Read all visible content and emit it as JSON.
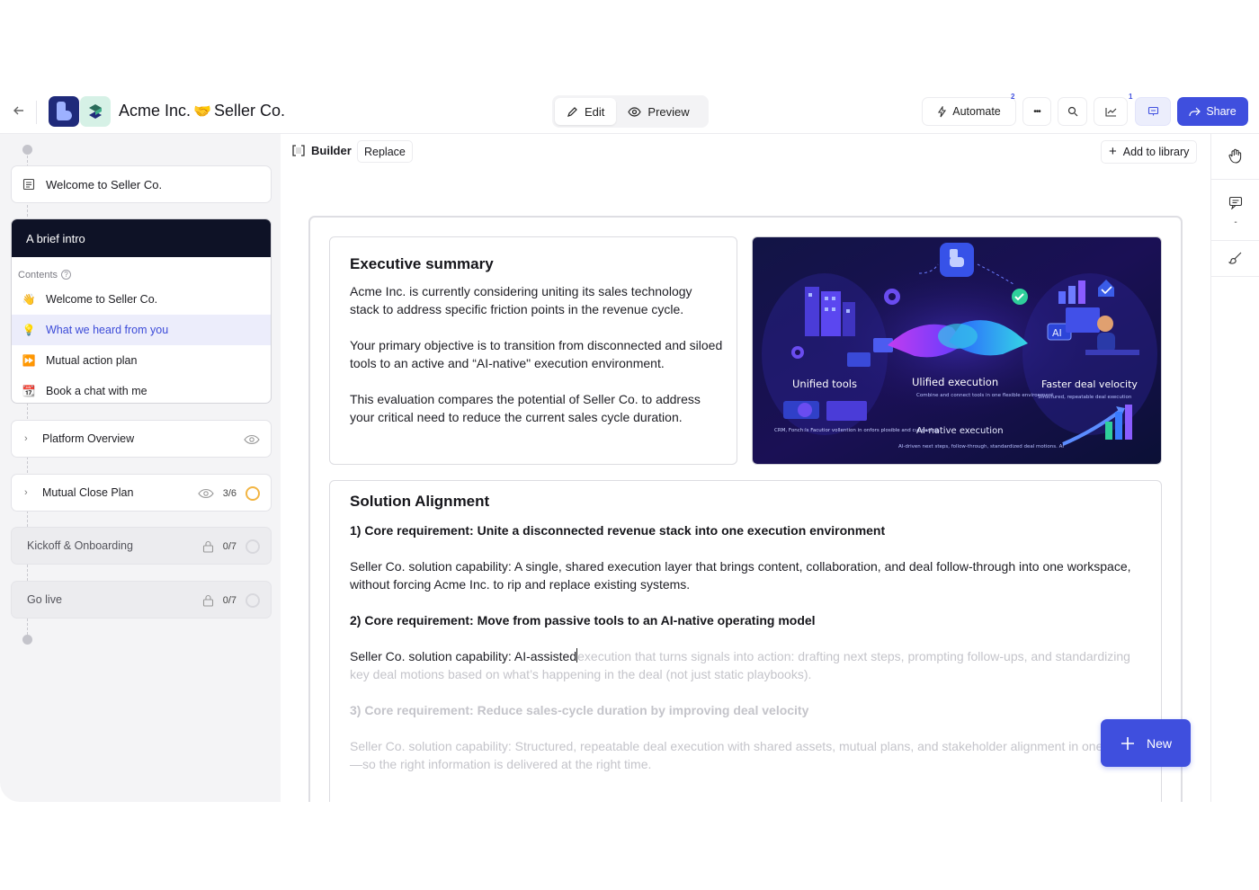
{
  "header": {
    "title_left": "Acme Inc.",
    "title_sep": "🤝",
    "title_right": "Seller Co.",
    "modes": [
      {
        "label": "Edit",
        "icon": "pencil-icon",
        "active": true
      },
      {
        "label": "Preview",
        "icon": "eye-icon",
        "active": false
      }
    ],
    "automate_label": "Automate",
    "automate_badge": "2",
    "activity_badge": "1",
    "share_label": "Share"
  },
  "sidebar": {
    "welcome_card": "Welcome to Seller Co.",
    "intro": {
      "title": "A brief intro",
      "contents_label": "Contents",
      "items": [
        {
          "label": "Welcome to Seller Co.",
          "icon": "👋",
          "active": false
        },
        {
          "label": "What we heard from you",
          "icon": "💡",
          "active": true
        },
        {
          "label": "Mutual action plan",
          "icon": "⏩",
          "active": false
        },
        {
          "label": "Book a chat with me",
          "icon": "📆",
          "active": false
        }
      ]
    },
    "sections": [
      {
        "label": "Platform Overview",
        "progress": ""
      },
      {
        "label": "Mutual Close Plan",
        "progress": "3/6"
      },
      {
        "label": "Kickoff & Onboarding",
        "progress": "0/7"
      },
      {
        "label": "Go live",
        "progress": "0/7"
      }
    ]
  },
  "toolbar": {
    "builder_label": "Builder",
    "replace_label": "Replace",
    "add_library_label": "Add to library"
  },
  "executive": {
    "title": "Executive summary",
    "paragraphs": [
      "Acme Inc. is currently considering uniting its sales technology stack to address specific friction points in the revenue cycle.",
      "Your primary objective is to transition from disconnected and siloed tools to an active and “AI-native\" execution environment.",
      "This evaluation compares the potential of Seller Co. to address your critical need to reduce the current sales cycle duration."
    ]
  },
  "illustration": {
    "label_unified_tools": "Unified tools",
    "label_unified_execution": "Ulified execution",
    "sub_unified_execution": "Combine and connect tools in one flexible environment",
    "label_velocity": "Faster deal velocity",
    "sub_velocity": "Structured, repeatable deal execution",
    "label_ai_native": "AI-native execution",
    "sub_ai_native": "AI-driven next steps, follow-through, standardized deal motions. AI",
    "sub_crm": "CRM, Fonch:ls Facutior vollention in onfors plosible and cunpaning.",
    "ai_tag": "AI"
  },
  "solution": {
    "title": "Solution Alignment",
    "req1": "1) Core requirement: Unite a disconnected revenue stack into one execution environment",
    "cap1": "Seller Co. solution capability: A single, shared execution layer that brings content, collaboration, and deal follow-through into one workspace, without forcing Acme Inc. to rip and replace existing systems.",
    "req2": "2) Core requirement: Move from passive tools to an AI-native operating model",
    "cap2_typed": "Seller Co. solution capability: AI-assisted",
    "cap2_pending": "execution that turns signals into action: drafting next steps, prompting follow-ups, and standardizing key deal motions based on what’s happening in the deal (not just static playbooks).",
    "req3": "3) Core requirement: Reduce sales-cycle duration by improving deal velocity",
    "cap3": "Seller Co. solution capability: Structured, repeatable deal execution with shared assets, mutual plans, and stakeholder alignment in one place—so the right information is delivered at the right time."
  },
  "fab": {
    "new_label": "New"
  },
  "colors": {
    "accent": "#3f4fde",
    "dark": "#0e1226"
  }
}
